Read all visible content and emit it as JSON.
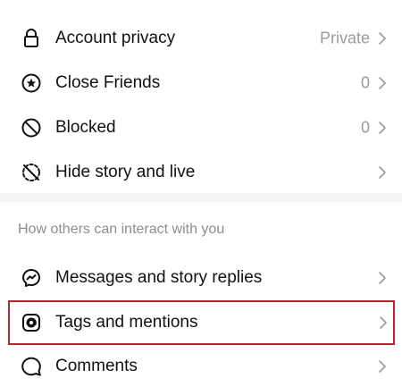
{
  "section_privacy": {
    "items": [
      {
        "label": "Account privacy",
        "value": "Private",
        "icon": "lock-icon"
      },
      {
        "label": "Close Friends",
        "value": "0",
        "icon": "star-circle-icon"
      },
      {
        "label": "Blocked",
        "value": "0",
        "icon": "blocked-icon"
      },
      {
        "label": "Hide story and live",
        "value": "",
        "icon": "hide-story-icon"
      }
    ]
  },
  "section_interact": {
    "header": "How others can interact with you",
    "items": [
      {
        "label": "Messages and story replies",
        "icon": "messenger-icon"
      },
      {
        "label": "Tags and mentions",
        "icon": "at-sign-icon",
        "highlighted": true
      },
      {
        "label": "Comments",
        "icon": "comment-icon"
      }
    ]
  },
  "colors": {
    "highlight_border": "#b3262d",
    "secondary_text": "#9a9a9a",
    "section_header_text": "#8e8e8e",
    "separator": "#f4f4f4"
  }
}
